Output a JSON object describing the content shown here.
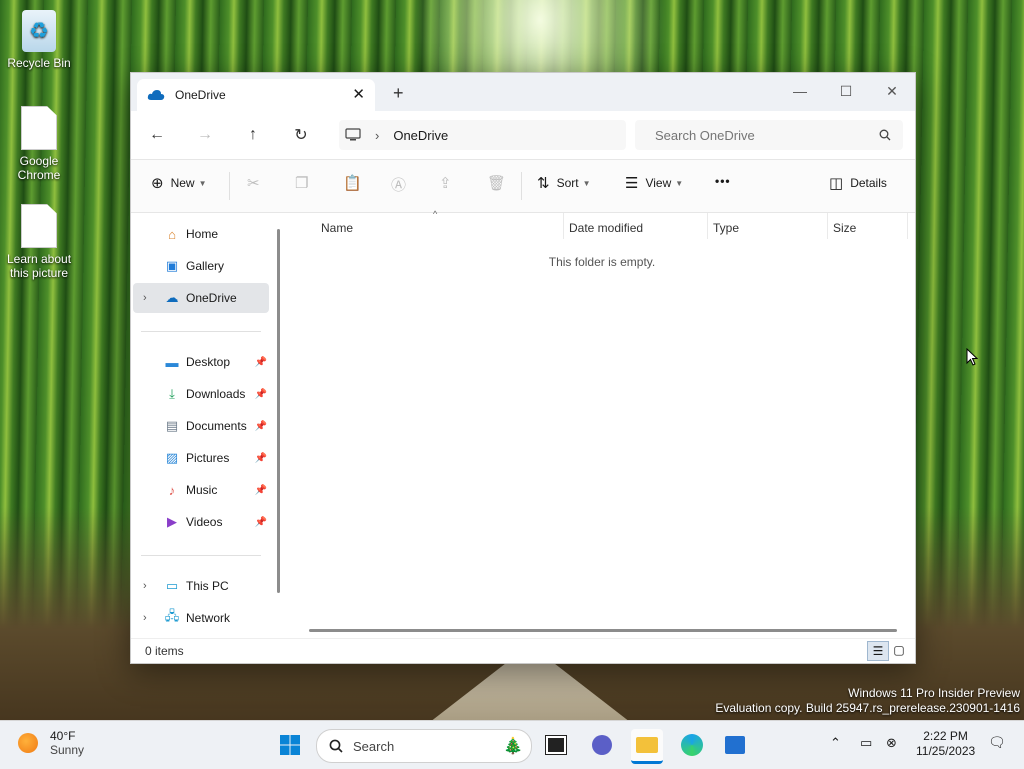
{
  "desktop": {
    "icons": [
      {
        "label": "Recycle Bin",
        "icon": "recycle-bin-icon"
      },
      {
        "label": "Google Chrome",
        "icon": "chrome-shortcut-icon"
      },
      {
        "label": "Learn about this picture",
        "icon": "learn-picture-icon"
      }
    ],
    "watermark": {
      "line1": "Windows 11 Pro Insider Preview",
      "line2": "Evaluation copy. Build 25947.rs_prerelease.230901-1416"
    }
  },
  "explorer": {
    "tab": {
      "title": "OneDrive",
      "close": "✕",
      "new_tab": "+"
    },
    "window_controls": {
      "minimize": "—",
      "maximize": "☐",
      "close": "✕"
    },
    "nav": {
      "back": "←",
      "forward": "→",
      "up": "↑",
      "refresh": "↻",
      "breadcrumb_sep": "›",
      "location": "OneDrive",
      "search_placeholder": "Search OneDrive"
    },
    "commands": {
      "new_label": "New",
      "sort_label": "Sort",
      "view_label": "View",
      "more": "•••",
      "details_label": "Details"
    },
    "sidebar": {
      "top": [
        {
          "label": "Home",
          "icon": "home-icon"
        },
        {
          "label": "Gallery",
          "icon": "gallery-icon"
        },
        {
          "label": "OneDrive",
          "icon": "onedrive-icon",
          "selected": true
        }
      ],
      "quick_access": [
        {
          "label": "Desktop",
          "icon": "desktop-folder-icon"
        },
        {
          "label": "Downloads",
          "icon": "downloads-icon"
        },
        {
          "label": "Documents",
          "icon": "documents-icon"
        },
        {
          "label": "Pictures",
          "icon": "pictures-icon"
        },
        {
          "label": "Music",
          "icon": "music-icon"
        },
        {
          "label": "Videos",
          "icon": "videos-icon"
        }
      ],
      "bottom": [
        {
          "label": "This PC",
          "icon": "this-pc-icon"
        },
        {
          "label": "Network",
          "icon": "network-icon"
        }
      ]
    },
    "columns": [
      "Name",
      "Date modified",
      "Type",
      "Size"
    ],
    "empty_message": "This folder is empty.",
    "status": {
      "item_count": "0 items"
    }
  },
  "taskbar": {
    "weather": {
      "temp": "40°F",
      "condition": "Sunny"
    },
    "search_label": "Search",
    "clock": {
      "time": "2:22 PM",
      "date": "11/25/2023"
    },
    "accent_color": "#0078d4"
  }
}
